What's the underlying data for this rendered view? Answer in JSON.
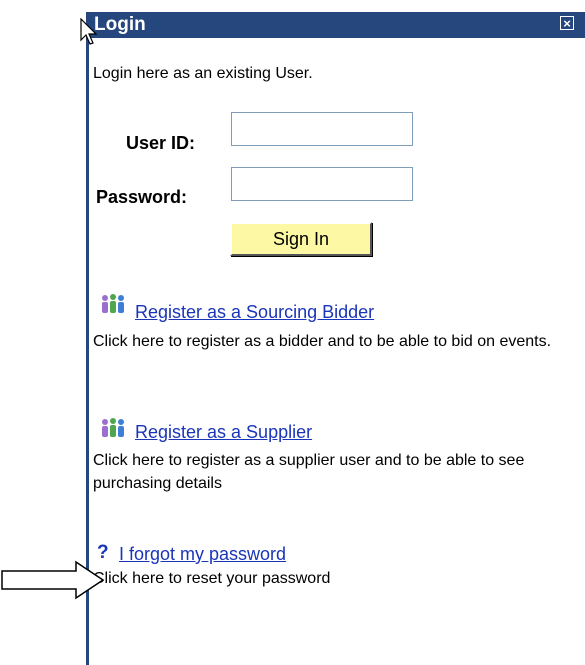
{
  "window": {
    "title": "Login"
  },
  "intro": "Login here as an existing User.",
  "form": {
    "user_label": "User ID:",
    "user_value": "",
    "password_label": "Password:",
    "password_value": "",
    "signin_label": "Sign In"
  },
  "links": [
    {
      "icon": "people-group-icon",
      "label": "Register as a Sourcing Bidder",
      "description": "Click here to register as a bidder and to be able to bid on events."
    },
    {
      "icon": "people-group-icon",
      "label": "Register as a Supplier",
      "description": "Click here to register as a supplier user and to be able to see purchasing details"
    },
    {
      "icon": "question-mark-icon",
      "label": "I forgot my password",
      "description": "Click here to reset your password"
    }
  ],
  "colors": {
    "titlebar": "#25477d",
    "link": "#1a35b8",
    "button": "#fdf8a4"
  },
  "icons": {
    "question": "?"
  }
}
